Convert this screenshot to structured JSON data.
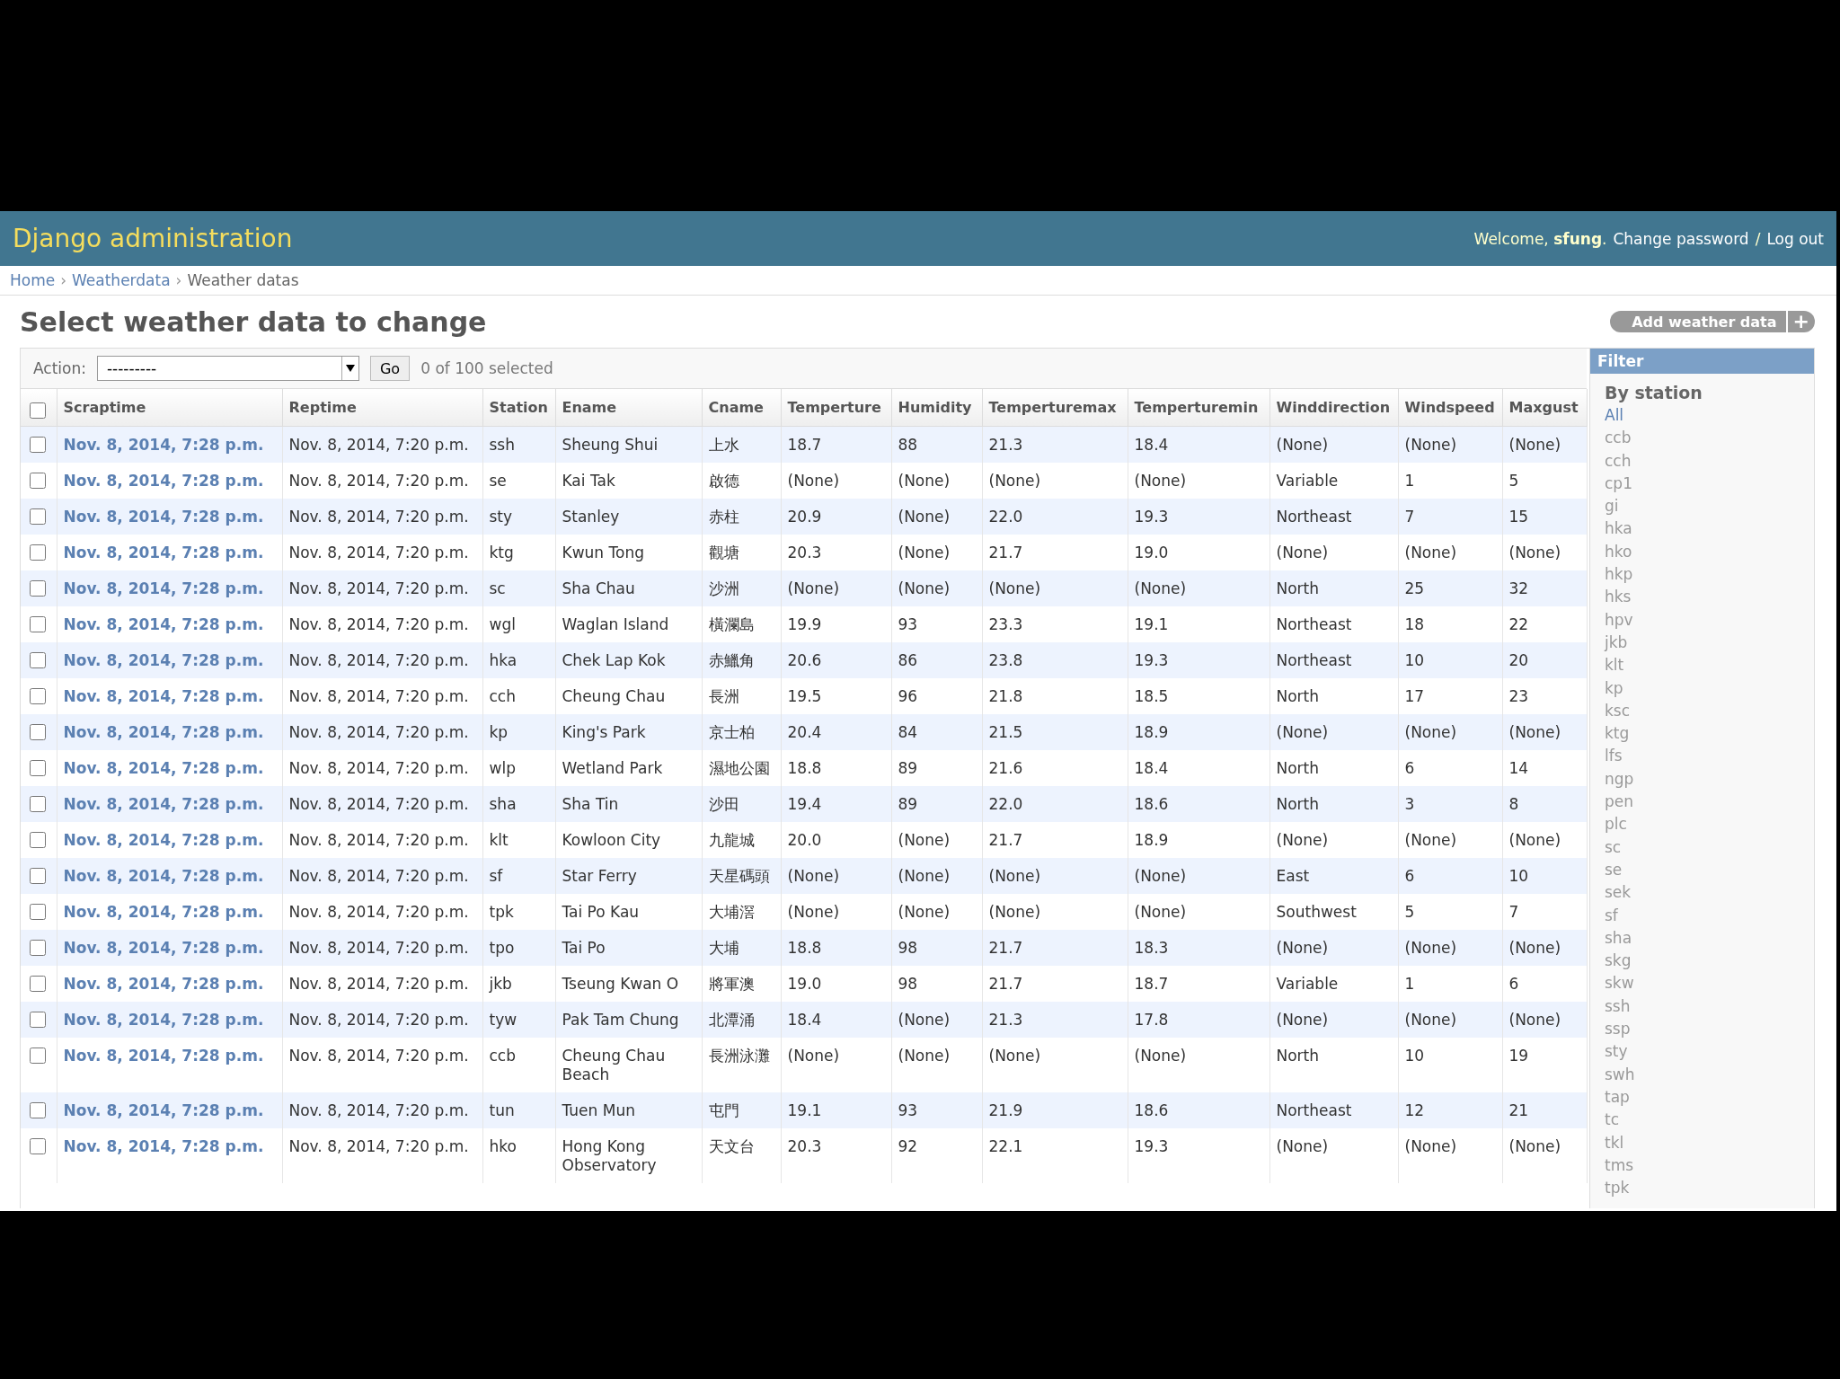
{
  "header": {
    "title": "Django administration",
    "welcome": "Welcome, **sfung**.",
    "links": [
      {
        "kind": "link",
        "label": "Change password"
      },
      {
        "kind": "sep",
        "label": "/"
      },
      {
        "kind": "link",
        "label": "Log out"
      }
    ]
  },
  "breadcrumbs": [
    {
      "kind": "link",
      "label": "Home"
    },
    {
      "kind": "sep",
      "label": "›"
    },
    {
      "kind": "link",
      "label": "Weatherdata"
    },
    {
      "kind": "sep",
      "label": "›"
    },
    {
      "kind": "current",
      "label": "Weather datas"
    }
  ],
  "page_title": "Select weather data to change",
  "add_button": {
    "label": "Add weather data",
    "icon": "+"
  },
  "actions": {
    "label": "Action:",
    "value": "---------",
    "go": "Go",
    "selection": "0 of 100 selected"
  },
  "select_all": {
    "checked": false
  },
  "columns": [
    "Scraptime",
    "Reptime",
    "Station",
    "Ename",
    "Cname",
    "Temperture",
    "Humidity",
    "Temperturemax",
    "Temperturemin",
    "Winddirection",
    "Windspeed",
    "Maxgust"
  ],
  "rows": [
    {
      "checked": false,
      "cells": [
        "Nov. 8, 2014, 7:28 p.m.",
        "Nov. 8, 2014, 7:20 p.m.",
        "ssh",
        "Sheung Shui",
        "上水",
        "18.7",
        "88",
        "21.3",
        "18.4",
        "(None)",
        "(None)",
        "(None)"
      ]
    },
    {
      "checked": false,
      "cells": [
        "Nov. 8, 2014, 7:28 p.m.",
        "Nov. 8, 2014, 7:20 p.m.",
        "se",
        "Kai Tak",
        "啟德",
        "(None)",
        "(None)",
        "(None)",
        "(None)",
        "Variable",
        "1",
        "5"
      ]
    },
    {
      "checked": false,
      "cells": [
        "Nov. 8, 2014, 7:28 p.m.",
        "Nov. 8, 2014, 7:20 p.m.",
        "sty",
        "Stanley",
        "赤柱",
        "20.9",
        "(None)",
        "22.0",
        "19.3",
        "Northeast",
        "7",
        "15"
      ]
    },
    {
      "checked": false,
      "cells": [
        "Nov. 8, 2014, 7:28 p.m.",
        "Nov. 8, 2014, 7:20 p.m.",
        "ktg",
        "Kwun Tong",
        "觀塘",
        "20.3",
        "(None)",
        "21.7",
        "19.0",
        "(None)",
        "(None)",
        "(None)"
      ]
    },
    {
      "checked": false,
      "cells": [
        "Nov. 8, 2014, 7:28 p.m.",
        "Nov. 8, 2014, 7:20 p.m.",
        "sc",
        "Sha Chau",
        "沙洲",
        "(None)",
        "(None)",
        "(None)",
        "(None)",
        "North",
        "25",
        "32"
      ]
    },
    {
      "checked": false,
      "cells": [
        "Nov. 8, 2014, 7:28 p.m.",
        "Nov. 8, 2014, 7:20 p.m.",
        "wgl",
        "Waglan Island",
        "橫瀾島",
        "19.9",
        "93",
        "23.3",
        "19.1",
        "Northeast",
        "18",
        "22"
      ]
    },
    {
      "checked": false,
      "cells": [
        "Nov. 8, 2014, 7:28 p.m.",
        "Nov. 8, 2014, 7:20 p.m.",
        "hka",
        "Chek Lap Kok",
        "赤鱲角",
        "20.6",
        "86",
        "23.8",
        "19.3",
        "Northeast",
        "10",
        "20"
      ]
    },
    {
      "checked": false,
      "cells": [
        "Nov. 8, 2014, 7:28 p.m.",
        "Nov. 8, 2014, 7:20 p.m.",
        "cch",
        "Cheung Chau",
        "長洲",
        "19.5",
        "96",
        "21.8",
        "18.5",
        "North",
        "17",
        "23"
      ]
    },
    {
      "checked": false,
      "cells": [
        "Nov. 8, 2014, 7:28 p.m.",
        "Nov. 8, 2014, 7:20 p.m.",
        "kp",
        "King's Park",
        "京士柏",
        "20.4",
        "84",
        "21.5",
        "18.9",
        "(None)",
        "(None)",
        "(None)"
      ]
    },
    {
      "checked": false,
      "cells": [
        "Nov. 8, 2014, 7:28 p.m.",
        "Nov. 8, 2014, 7:20 p.m.",
        "wlp",
        "Wetland Park",
        "濕地公園",
        "18.8",
        "89",
        "21.6",
        "18.4",
        "North",
        "6",
        "14"
      ]
    },
    {
      "checked": false,
      "cells": [
        "Nov. 8, 2014, 7:28 p.m.",
        "Nov. 8, 2014, 7:20 p.m.",
        "sha",
        "Sha Tin",
        "沙田",
        "19.4",
        "89",
        "22.0",
        "18.6",
        "North",
        "3",
        "8"
      ]
    },
    {
      "checked": false,
      "cells": [
        "Nov. 8, 2014, 7:28 p.m.",
        "Nov. 8, 2014, 7:20 p.m.",
        "klt",
        "Kowloon City",
        "九龍城",
        "20.0",
        "(None)",
        "21.7",
        "18.9",
        "(None)",
        "(None)",
        "(None)"
      ]
    },
    {
      "checked": false,
      "cells": [
        "Nov. 8, 2014, 7:28 p.m.",
        "Nov. 8, 2014, 7:20 p.m.",
        "sf",
        "Star Ferry",
        "天星碼頭",
        "(None)",
        "(None)",
        "(None)",
        "(None)",
        "East",
        "6",
        "10"
      ]
    },
    {
      "checked": false,
      "cells": [
        "Nov. 8, 2014, 7:28 p.m.",
        "Nov. 8, 2014, 7:20 p.m.",
        "tpk",
        "Tai Po Kau",
        "大埔滘",
        "(None)",
        "(None)",
        "(None)",
        "(None)",
        "Southwest",
        "5",
        "7"
      ]
    },
    {
      "checked": false,
      "cells": [
        "Nov. 8, 2014, 7:28 p.m.",
        "Nov. 8, 2014, 7:20 p.m.",
        "tpo",
        "Tai Po",
        "大埔",
        "18.8",
        "98",
        "21.7",
        "18.3",
        "(None)",
        "(None)",
        "(None)"
      ]
    },
    {
      "checked": false,
      "cells": [
        "Nov. 8, 2014, 7:28 p.m.",
        "Nov. 8, 2014, 7:20 p.m.",
        "jkb",
        "Tseung Kwan O",
        "將軍澳",
        "19.0",
        "98",
        "21.7",
        "18.7",
        "Variable",
        "1",
        "6"
      ]
    },
    {
      "checked": false,
      "cells": [
        "Nov. 8, 2014, 7:28 p.m.",
        "Nov. 8, 2014, 7:20 p.m.",
        "tyw",
        "Pak Tam Chung",
        "北潭涌",
        "18.4",
        "(None)",
        "21.3",
        "17.8",
        "(None)",
        "(None)",
        "(None)"
      ]
    },
    {
      "checked": false,
      "cells": [
        "Nov. 8, 2014, 7:28 p.m.",
        "Nov. 8, 2014, 7:20 p.m.",
        "ccb",
        "Cheung Chau Beach",
        "長洲泳灘",
        "(None)",
        "(None)",
        "(None)",
        "(None)",
        "North",
        "10",
        "19"
      ]
    },
    {
      "checked": false,
      "cells": [
        "Nov. 8, 2014, 7:28 p.m.",
        "Nov. 8, 2014, 7:20 p.m.",
        "tun",
        "Tuen Mun",
        "屯門",
        "19.1",
        "93",
        "21.9",
        "18.6",
        "Northeast",
        "12",
        "21"
      ]
    },
    {
      "checked": false,
      "cells": [
        "Nov. 8, 2014, 7:28 p.m.",
        "Nov. 8, 2014, 7:20 p.m.",
        "hko",
        "Hong Kong Observatory",
        "天文台",
        "20.3",
        "92",
        "22.1",
        "19.3",
        "(None)",
        "(None)",
        "(None)"
      ]
    }
  ],
  "filter": {
    "title": "Filter",
    "heading": "By station",
    "items": [
      {
        "label": "All",
        "selected": true
      },
      {
        "label": "ccb",
        "selected": false
      },
      {
        "label": "cch",
        "selected": false
      },
      {
        "label": "cp1",
        "selected": false
      },
      {
        "label": "gi",
        "selected": false
      },
      {
        "label": "hka",
        "selected": false
      },
      {
        "label": "hko",
        "selected": false
      },
      {
        "label": "hkp",
        "selected": false
      },
      {
        "label": "hks",
        "selected": false
      },
      {
        "label": "hpv",
        "selected": false
      },
      {
        "label": "jkb",
        "selected": false
      },
      {
        "label": "klt",
        "selected": false
      },
      {
        "label": "kp",
        "selected": false
      },
      {
        "label": "ksc",
        "selected": false
      },
      {
        "label": "ktg",
        "selected": false
      },
      {
        "label": "lfs",
        "selected": false
      },
      {
        "label": "ngp",
        "selected": false
      },
      {
        "label": "pen",
        "selected": false
      },
      {
        "label": "plc",
        "selected": false
      },
      {
        "label": "sc",
        "selected": false
      },
      {
        "label": "se",
        "selected": false
      },
      {
        "label": "sek",
        "selected": false
      },
      {
        "label": "sf",
        "selected": false
      },
      {
        "label": "sha",
        "selected": false
      },
      {
        "label": "skg",
        "selected": false
      },
      {
        "label": "skw",
        "selected": false
      },
      {
        "label": "ssh",
        "selected": false
      },
      {
        "label": "ssp",
        "selected": false
      },
      {
        "label": "sty",
        "selected": false
      },
      {
        "label": "swh",
        "selected": false
      },
      {
        "label": "tap",
        "selected": false
      },
      {
        "label": "tc",
        "selected": false
      },
      {
        "label": "tkl",
        "selected": false
      },
      {
        "label": "tms",
        "selected": false
      },
      {
        "label": "tpk",
        "selected": false
      }
    ]
  }
}
